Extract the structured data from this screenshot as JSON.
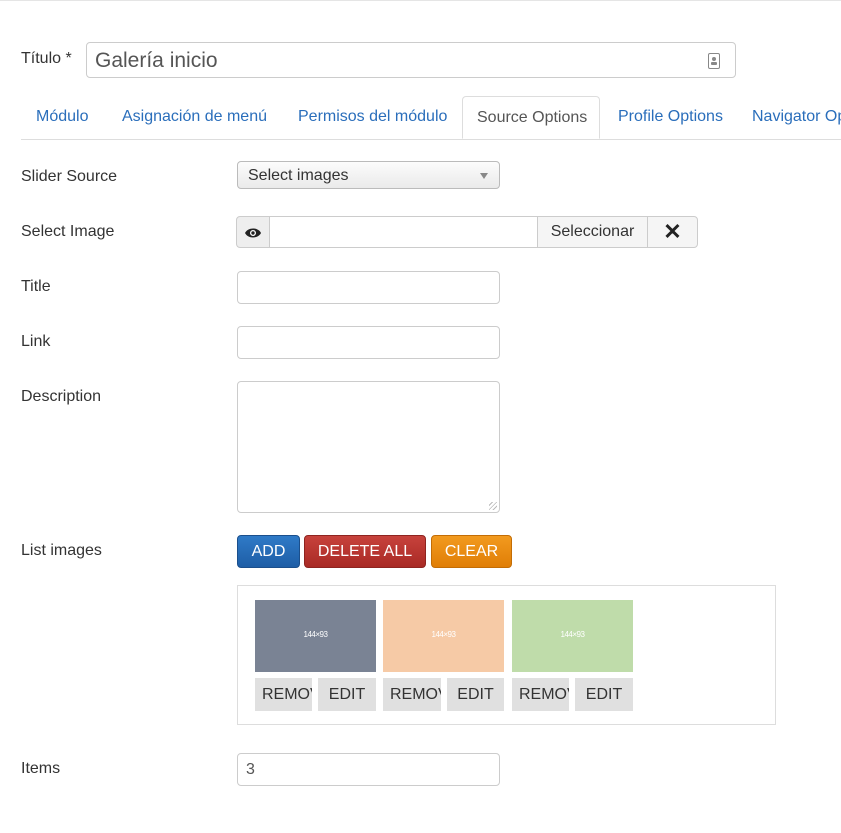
{
  "title_field": {
    "label": "Título *",
    "value": "Galería inicio"
  },
  "tabs": [
    {
      "label": "Módulo",
      "active": false
    },
    {
      "label": "Asignación de menú",
      "active": false
    },
    {
      "label": "Permisos del módulo",
      "active": false
    },
    {
      "label": "Source Options",
      "active": true
    },
    {
      "label": "Profile Options",
      "active": false
    },
    {
      "label": "Navigator Op",
      "active": false
    }
  ],
  "form": {
    "slider_source": {
      "label": "Slider Source",
      "selected": "Select images"
    },
    "select_image": {
      "label": "Select Image",
      "path": "",
      "select_button": "Seleccionar",
      "clear_icon": "x-icon",
      "preview_icon": "eye-icon"
    },
    "title": {
      "label": "Title",
      "value": ""
    },
    "link": {
      "label": "Link",
      "value": ""
    },
    "description": {
      "label": "Description",
      "value": ""
    },
    "list_images": {
      "label": "List images",
      "add": "ADD",
      "delete_all": "DELETE ALL",
      "clear": "CLEAR",
      "images": [
        {
          "caption": "144×93",
          "color": "#7a8394",
          "remove": "REMOVE",
          "edit": "EDIT"
        },
        {
          "caption": "144×93",
          "color": "#f6caa6",
          "remove": "REMOVE",
          "edit": "EDIT"
        },
        {
          "caption": "144×93",
          "color": "#bfdcaa",
          "remove": "REMOVE",
          "edit": "EDIT"
        }
      ]
    },
    "items": {
      "label": "Items",
      "value": "3"
    }
  },
  "colors": {
    "link": "#2a6ebb",
    "add_button": "#2f7ac7",
    "delete_button": "#b9342f",
    "clear_button": "#ec8e13"
  }
}
